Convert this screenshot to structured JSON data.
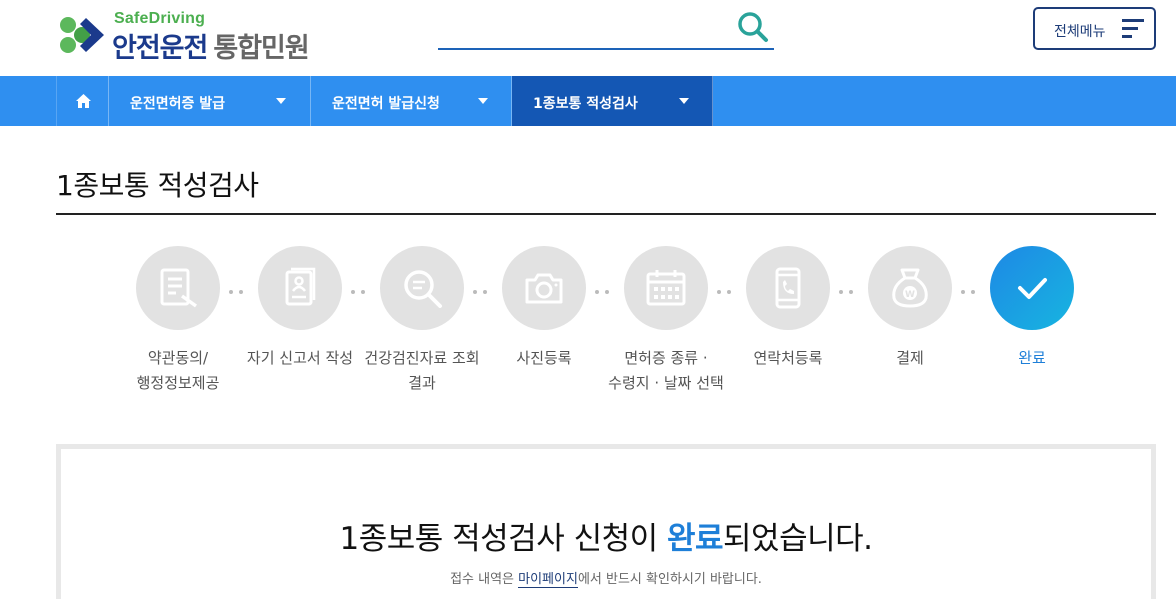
{
  "header": {
    "logo_en": "SafeDriving",
    "logo_ko_main": "안전운전",
    "logo_ko_sub": "통합민원",
    "search_placeholder": "",
    "menu_label": "전체메뉴"
  },
  "nav": {
    "crumbs": [
      {
        "label": "운전면허증 발급"
      },
      {
        "label": "운전면허 발급신청"
      },
      {
        "label": "1종보통 적성검사"
      }
    ]
  },
  "page": {
    "title": "1종보통 적성검사"
  },
  "steps": [
    {
      "line1": "약관동의/",
      "line2": "행정정보제공",
      "icon": "document-pen-icon"
    },
    {
      "line1": "자기 신고서 작성",
      "line2": "",
      "icon": "self-report-icon"
    },
    {
      "line1": "건강검진자료 조회",
      "line2": "결과",
      "icon": "search-document-icon"
    },
    {
      "line1": "사진등록",
      "line2": "",
      "icon": "camera-icon"
    },
    {
      "line1": "면허증 종류 ·",
      "line2": "수령지 · 날짜 선택",
      "icon": "calendar-icon"
    },
    {
      "line1": "연락처등록",
      "line2": "",
      "icon": "phone-icon"
    },
    {
      "line1": "결제",
      "line2": "",
      "icon": "money-bag-icon"
    },
    {
      "line1": "완료",
      "line2": "",
      "icon": "check-icon"
    }
  ],
  "result": {
    "msg_pre": "1종보통 적성검사 신청이 ",
    "msg_hl": "완료",
    "msg_post": "되었습니다.",
    "sub_pre": "접수 내역은 ",
    "sub_link": "마이페이지",
    "sub_post": "에서 반드시 확인하시기 바랍니다."
  },
  "colors": {
    "nav_bg": "#2f8ff0",
    "nav_active": "#1457b4",
    "accent": "#1e7fd8",
    "brand_navy": "#1d3c78",
    "brand_green": "#4caf50"
  }
}
